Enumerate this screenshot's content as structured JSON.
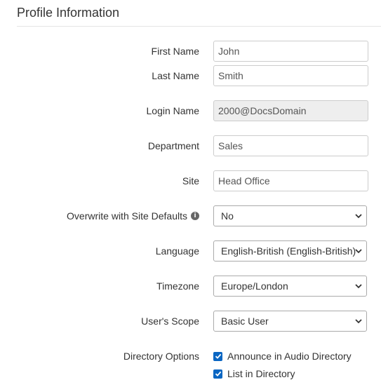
{
  "section": {
    "title": "Profile Information"
  },
  "fields": {
    "first_name": {
      "label": "First Name",
      "value": "John"
    },
    "last_name": {
      "label": "Last Name",
      "value": "Smith"
    },
    "login_name": {
      "label": "Login Name",
      "value": "2000@DocsDomain"
    },
    "department": {
      "label": "Department",
      "value": "Sales"
    },
    "site": {
      "label": "Site",
      "value": "Head Office"
    },
    "overwrite": {
      "label": "Overwrite with Site Defaults",
      "value": "No",
      "icon": "info-icon"
    },
    "language": {
      "label": "Language",
      "value": "English-British (English-British)"
    },
    "timezone": {
      "label": "Timezone",
      "value": "Europe/London"
    },
    "scope": {
      "label": "User's Scope",
      "value": "Basic User"
    }
  },
  "directory": {
    "label": "Directory Options",
    "options": [
      {
        "label": "Announce in Audio Directory",
        "checked": true
      },
      {
        "label": "List in Directory",
        "checked": true
      }
    ]
  },
  "colors": {
    "checkbox": "#0a66c2",
    "readonly_bg": "#eeeeee"
  }
}
